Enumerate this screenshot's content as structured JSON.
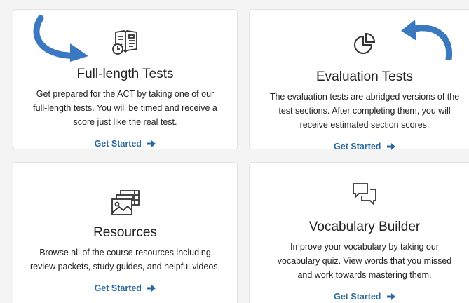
{
  "cards": [
    {
      "title": "Full-length Tests",
      "description": "Get prepared for the ACT by taking one of our full-length tests. You will be timed and receive a score just like the real test.",
      "link": "Get Started",
      "icon": "test-book-clock-icon"
    },
    {
      "title": "Evaluation Tests",
      "description": "The evaluation tests are abridged versions of the test sections. After completing them, you will receive estimated section scores.",
      "link": "Get Started",
      "icon": "pie-chart-icon"
    },
    {
      "title": "Resources",
      "description": "Browse all of the course resources including review packets, study guides, and helpful videos.",
      "link": "Get Started",
      "icon": "media-gallery-icon"
    },
    {
      "title": "Vocabulary Builder",
      "description": "Improve your vocabulary by taking our vocabulary quiz. View words that you missed and work towards mastering them.",
      "link": "Get Started",
      "icon": "chat-bubbles-icon"
    }
  ],
  "colors": {
    "link": "#2b6aa0",
    "annotation_arrow": "#3a78c0",
    "card_border": "#e3e3e3",
    "background": "#f4f4f5"
  }
}
